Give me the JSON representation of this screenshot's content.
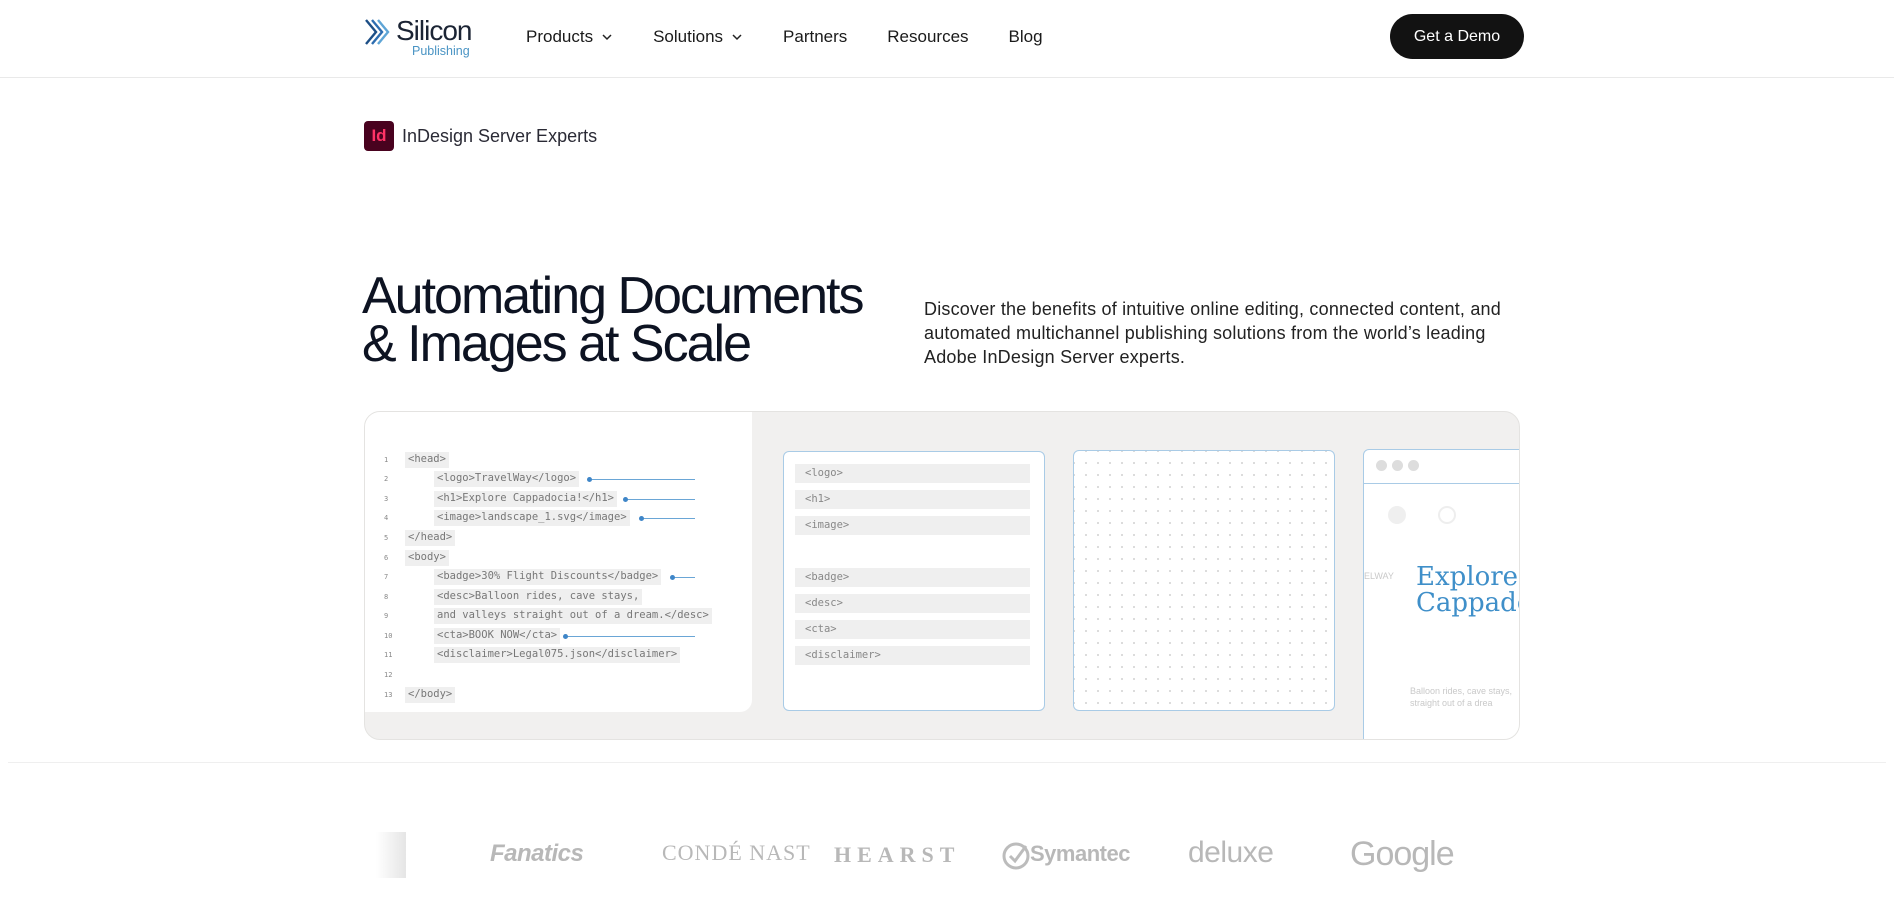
{
  "header": {
    "logo_word": "Silicon",
    "logo_sub": "Publishing",
    "nav": [
      {
        "label": "Products"
      },
      {
        "label": "Solutions"
      },
      {
        "label": "Partners"
      },
      {
        "label": "Resources"
      },
      {
        "label": "Blog"
      }
    ],
    "cta_label": "Get a Demo"
  },
  "badge": {
    "icon_text": "Id",
    "label": "InDesign Server Experts"
  },
  "hero": {
    "title_line1": "Automating Documents",
    "title_line2": "& Images at Scale",
    "description": "Discover the benefits of intuitive online editing, connected content, and automated multichannel publishing solutions from the world’s leading Adobe InDesign Server experts."
  },
  "illustration": {
    "code_lines": [
      {
        "n": "1",
        "text": "<head>"
      },
      {
        "n": "2",
        "text": "<logo>TravelWay</logo>"
      },
      {
        "n": "3",
        "text": "<h1>Explore Cappadocia!</h1>"
      },
      {
        "n": "4",
        "text": "<image>landscape_1.svg</image>"
      },
      {
        "n": "5",
        "text": "</head>"
      },
      {
        "n": "6",
        "text": "<body>"
      },
      {
        "n": "7",
        "text": "<badge>30% Flight Discounts</badge>"
      },
      {
        "n": "8",
        "text": "<desc>Balloon rides, cave stays,"
      },
      {
        "n": "9",
        "text": "and valleys straight out of a dream.</desc>"
      },
      {
        "n": "10",
        "text": "<cta>BOOK NOW</cta>"
      },
      {
        "n": "11",
        "text": "<disclaimer>Legal075.json</disclaimer>"
      },
      {
        "n": "12",
        "text": ""
      },
      {
        "n": "13",
        "text": "</body>"
      }
    ],
    "fields": [
      "<logo>",
      "<h1>",
      "<image>",
      "<badge>",
      "<desc>",
      "<cta>",
      "<disclaimer>"
    ],
    "preview_heading_line1": "Explore",
    "preview_heading_line2": "Cappado",
    "preview_brand": "ELWAY",
    "preview_body": "Balloon rides, cave stays,",
    "preview_body2": "straight out of a drea"
  },
  "clients": [
    "Fanatics",
    "CONDÉ NAST",
    "HEARST",
    "Symantec",
    "deluxe",
    "Google"
  ]
}
